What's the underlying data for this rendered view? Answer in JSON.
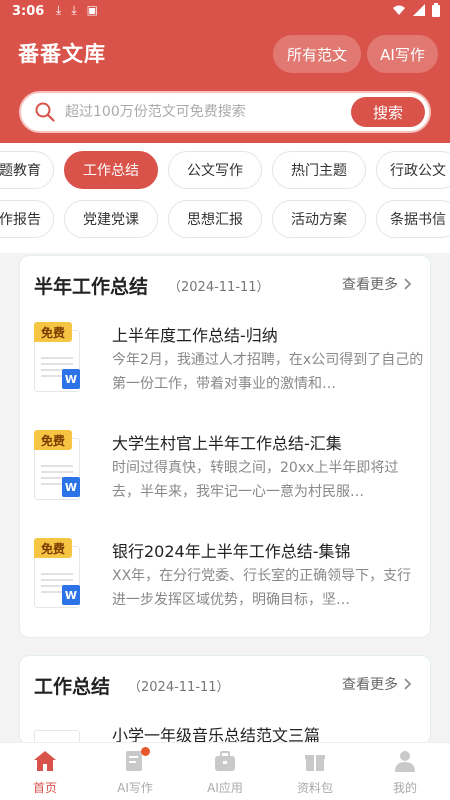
{
  "status": {
    "time": "3:06",
    "icons": [
      "download-icon",
      "download-icon",
      "a-icon"
    ],
    "right": [
      "wifi-icon",
      "signal-icon",
      "battery-icon"
    ]
  },
  "header": {
    "title": "番番文库",
    "all_docs": "所有范文",
    "ai_write": "AI写作"
  },
  "search": {
    "placeholder": "超过100万份范文可免费搜索",
    "button": "搜索"
  },
  "tags": {
    "row1": [
      "题教育",
      "工作总结",
      "公文写作",
      "热门主题",
      "行政公文"
    ],
    "row2": [
      "作报告",
      "党建党课",
      "思想汇报",
      "活动方案",
      "条据书信"
    ],
    "active": "工作总结"
  },
  "sections": [
    {
      "title": "半年工作总结",
      "date": "（2024-11-11）",
      "more": "查看更多",
      "docs": [
        {
          "badge": "免费",
          "type": "W",
          "title": "上半年度工作总结-归纳",
          "desc": "今年2月，我通过人才招聘，在x公司得到了自己的第一份工作，带着对事业的激情和…"
        },
        {
          "badge": "免费",
          "type": "W",
          "title": "大学生村官上半年工作总结-汇集",
          "desc": "时间过得真快，转眼之间，20xx上半年即将过去，半年来，我牢记一心一意为村民服…"
        },
        {
          "badge": "免费",
          "type": "W",
          "title": "银行2024年上半年工作总结-集锦",
          "desc": "XX年，在分行党委、行长室的正确领导下，支行进一步发挥区域优势，明确目标，坚…"
        }
      ]
    },
    {
      "title": "工作总结",
      "date": "（2024-11-11）",
      "more": "查看更多",
      "docs": [
        {
          "title": "小学一年级音乐总结范文三篇"
        }
      ]
    }
  ],
  "nav": [
    {
      "label": "首页",
      "icon": "home-icon",
      "active": true
    },
    {
      "label": "AI写作",
      "icon": "edit-doc-icon",
      "active": false
    },
    {
      "label": "AI应用",
      "icon": "briefcase-icon",
      "active": false
    },
    {
      "label": "资料包",
      "icon": "gift-icon",
      "active": false
    },
    {
      "label": "我的",
      "icon": "user-icon",
      "active": false
    }
  ],
  "colors": {
    "brand": "#d9534a",
    "free_badge": "#f6c544",
    "word_blue": "#2b73e6"
  }
}
